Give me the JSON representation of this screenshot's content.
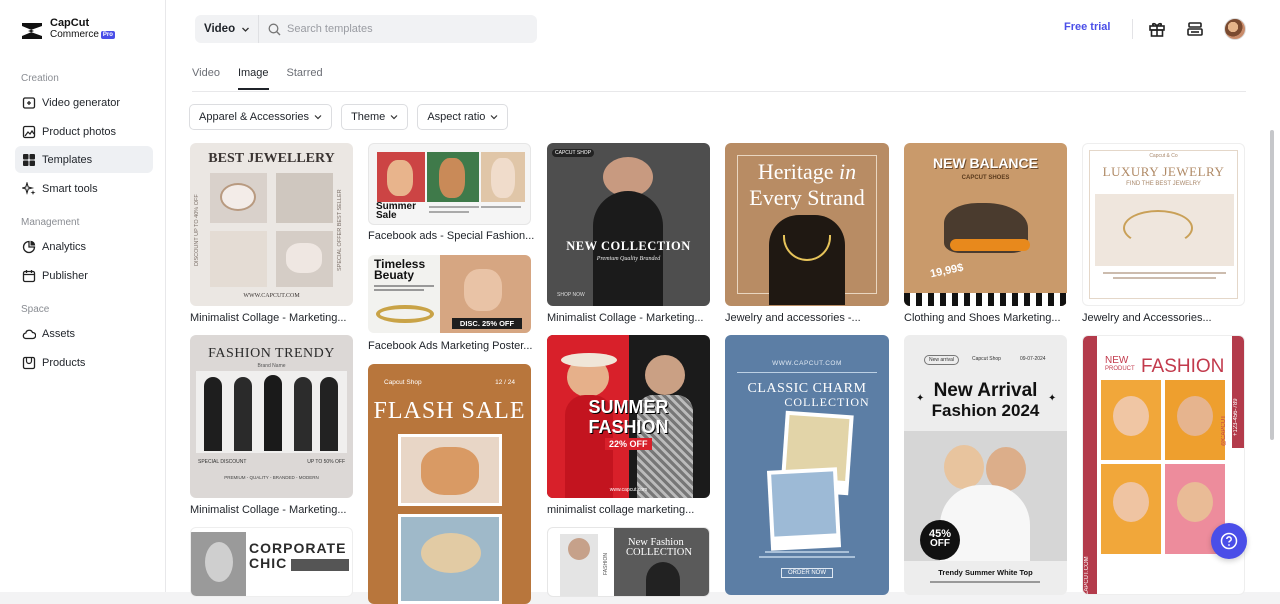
{
  "brand": {
    "line1": "CapCut",
    "line2": "Commerce",
    "badge": "Pro"
  },
  "sidebar": {
    "sections": [
      {
        "label": "Creation",
        "items": [
          {
            "label": "Video generator",
            "icon": "video-plus-icon"
          },
          {
            "label": "Product photos",
            "icon": "image-icon"
          },
          {
            "label": "Templates",
            "icon": "templates-icon",
            "active": true
          },
          {
            "label": "Smart tools",
            "icon": "sparkle-icon"
          }
        ]
      },
      {
        "label": "Management",
        "items": [
          {
            "label": "Analytics",
            "icon": "analytics-icon"
          },
          {
            "label": "Publisher",
            "icon": "calendar-icon"
          }
        ]
      },
      {
        "label": "Space",
        "items": [
          {
            "label": "Assets",
            "icon": "cloud-icon"
          },
          {
            "label": "Products",
            "icon": "products-icon"
          }
        ]
      }
    ]
  },
  "header": {
    "type_select": "Video",
    "search_placeholder": "Search templates",
    "free_trial": "Free trial"
  },
  "tabs": [
    {
      "label": "Video"
    },
    {
      "label": "Image",
      "active": true
    },
    {
      "label": "Starred"
    }
  ],
  "filters": [
    {
      "label": "Apparel & Accessories"
    },
    {
      "label": "Theme"
    },
    {
      "label": "Aspect ratio"
    }
  ],
  "colors": {
    "accent": "#4a4ee8"
  },
  "templates": [
    {
      "caption": "Minimalist Collage - Marketing...",
      "title": "BEST JEWELLERY",
      "side_left": "DISCOUNT UP TO 40% OFF",
      "side_right": "SPECIAL OFFER BEST SELLER",
      "footer": "WWW.CAPCUT.COM"
    },
    {
      "caption": "Facebook ads - Special Fashion...",
      "title": "Summer Sale"
    },
    {
      "caption": "Facebook Ads Marketing Poster...",
      "title": "Timeless Beuaty",
      "badge": "DISC. 25% OFF"
    },
    {
      "caption": "Minimalist Collage - Marketing...",
      "brand": "CAPCUT SHOP",
      "title": "NEW COLLECTION",
      "sub": "Premium  Quality  Branded",
      "footer": "SHOP NOW"
    },
    {
      "caption": "Jewelry and accessories -...",
      "title1": "Heritage",
      "title_in": "in",
      "title2": "Every Strand"
    },
    {
      "caption": "Clothing and Shoes Marketing...",
      "title": "NEW BALANCE",
      "sub": "CAPCUT SHOES",
      "price": "19,99$"
    },
    {
      "caption": "Jewelry and Accessories...",
      "brand": "Capcut & Co",
      "title": "LUXURY JEWELRY",
      "sub": "FIND THE BEST JEWELRY"
    },
    {
      "caption": "Minimalist Collage - Marketing...",
      "title": "FASHION TRENDY",
      "sub": "Brand Name",
      "left": "SPECIAL DISCOUNT",
      "right": "UP TO 50% OFF",
      "tags": "PREMIUM - QUALITY - BRANDED - MODERN"
    },
    {
      "caption": "",
      "title1": "CORPORATE",
      "title2": "CHIC"
    },
    {
      "caption": "",
      "brand": "Capcut Shop",
      "date": "12 / 24",
      "title": "FLASH SALE"
    },
    {
      "caption": "minimalist collage marketing...",
      "title1": "SUMMER",
      "title2": "FASHION",
      "badge": "22% OFF",
      "footer": "www.capcut.com"
    },
    {
      "caption": "",
      "title": "New Fashion",
      "title2": "COLLECTION",
      "side": "FASHION"
    },
    {
      "caption": "",
      "url": "WWW.CAPCUT.COM",
      "title": "CLASSIC CHARM",
      "sub": "COLLECTION",
      "footer": "ORDER NOW"
    },
    {
      "caption": "",
      "tag": "New arrival",
      "shop": "Capcut Shop",
      "date": "09-07-2024",
      "title": "New Arrival",
      "title2": "Fashion 2024",
      "badge1": "45%",
      "badge2": "OFF",
      "desc": "Trendy Summer White Top"
    },
    {
      "caption": "",
      "t1": "NEW",
      "t2": "PRODUCT",
      "title": "FASHION",
      "side": "+123-456-789",
      "side2": "@CAPCUT",
      "side3": "CAPCUT.COM"
    }
  ]
}
